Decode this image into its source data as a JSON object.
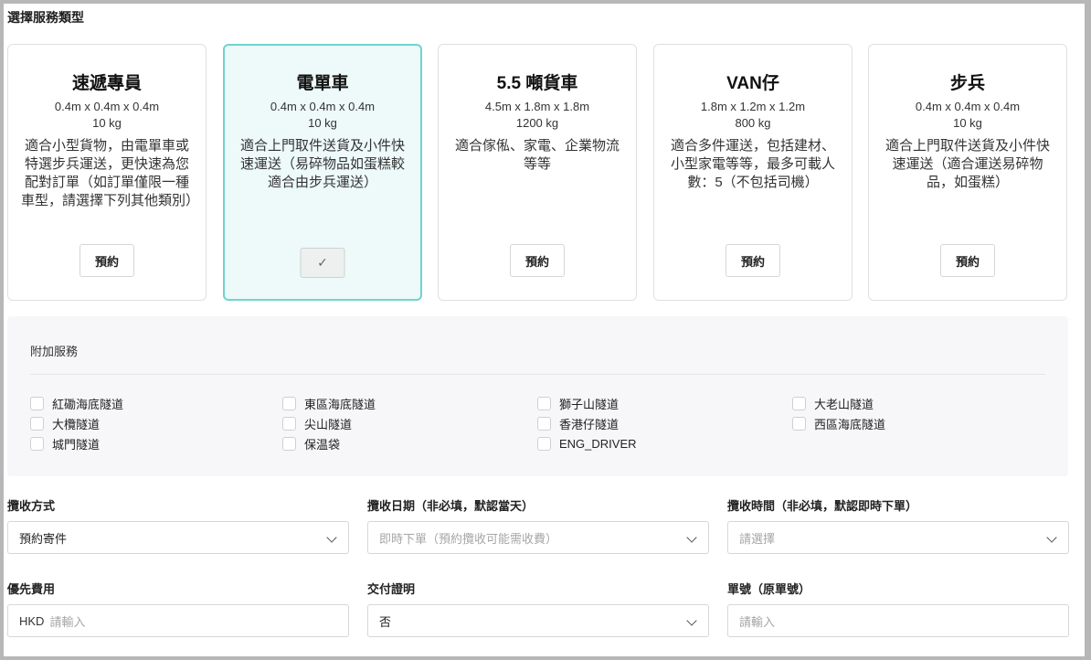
{
  "page_title": "選擇服務類型",
  "service_types": [
    {
      "name": "速遞專員",
      "dimensions": "0.4m x 0.4m x 0.4m",
      "weight": "10 kg",
      "description": "適合小型貨物，由電單車或特選步兵運送，更快速為您配對訂單（如訂單僅限一種車型，請選擇下列其他類別）",
      "button": "預約",
      "selected": false
    },
    {
      "name": "電單車",
      "dimensions": "0.4m x 0.4m x 0.4m",
      "weight": "10 kg",
      "description": "適合上門取件送貨及小件快速運送（易碎物品如蛋糕較適合由步兵運送）",
      "button": "✓",
      "selected": true
    },
    {
      "name": "5.5 噸貨車",
      "dimensions": "4.5m x 1.8m x 1.8m",
      "weight": "1200 kg",
      "description": "適合傢俬、家電、企業物流等等",
      "button": "預約",
      "selected": false
    },
    {
      "name": "VAN仔",
      "dimensions": "1.8m x 1.2m x 1.2m",
      "weight": "800 kg",
      "description": "適合多件運送，包括建材、小型家電等等，最多可載人數：5（不包括司機）",
      "button": "預約",
      "selected": false
    },
    {
      "name": "步兵",
      "dimensions": "0.4m x 0.4m x 0.4m",
      "weight": "10 kg",
      "description": "適合上門取件送貨及小件快速運送（適合運送易碎物品，如蛋糕）",
      "button": "預約",
      "selected": false
    }
  ],
  "addons": {
    "title": "附加服務",
    "options": [
      "紅磡海底隧道",
      "大欖隧道",
      "城門隧道",
      "東區海底隧道",
      "尖山隧道",
      "保温袋",
      "獅子山隧道",
      "香港仔隧道",
      "ENG_DRIVER",
      "大老山隧道",
      "西區海底隧道"
    ]
  },
  "form": {
    "pickup_method": {
      "label": "攬收方式",
      "value": "預約寄件"
    },
    "pickup_date": {
      "label": "攬收日期（非必填，默認當天）",
      "placeholder": "即時下單（預約攬收可能需收費）"
    },
    "pickup_time": {
      "label": "攬收時間（非必填，默認即時下單）",
      "placeholder": "請選擇"
    },
    "priority_fee": {
      "label": "優先費用",
      "prefix": "HKD",
      "placeholder": "請輸入"
    },
    "delivery_proof": {
      "label": "交付證明",
      "value": "否"
    },
    "order_number": {
      "label": "單號（原單號）",
      "placeholder": "請輸入"
    }
  },
  "colors": {
    "selected_border": "#6fd4cf",
    "selected_bg": "#edfaf9"
  }
}
